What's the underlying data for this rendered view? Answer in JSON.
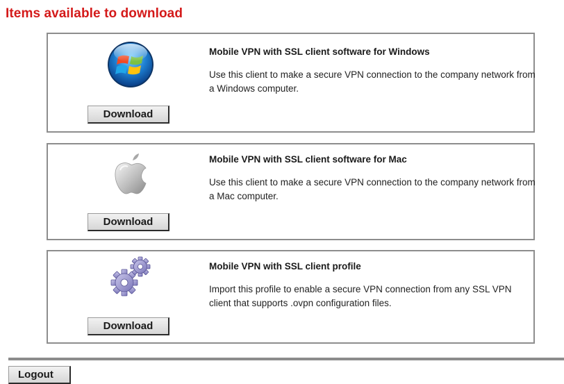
{
  "page_title": "Items available to download",
  "items": [
    {
      "icon": "windows-logo-icon",
      "heading": "Mobile VPN with SSL client software for Windows",
      "description": "Use this client to make a secure VPN connection to the company network from a Windows computer.",
      "button_label": "Download"
    },
    {
      "icon": "apple-logo-icon",
      "heading": "Mobile VPN with SSL client software for Mac",
      "description": "Use this client to make a secure VPN connection to the company network from a Mac computer.",
      "button_label": "Download"
    },
    {
      "icon": "gears-icon",
      "heading": "Mobile VPN with SSL client profile",
      "description": "Import this profile to enable a secure VPN connection from any SSL VPN client that supports .ovpn configuration files.",
      "button_label": "Download"
    }
  ],
  "logout_label": "Logout",
  "colors": {
    "title": "#d41a1a",
    "card_border": "#8d8d8d",
    "button_face": "#e4e4e4"
  }
}
